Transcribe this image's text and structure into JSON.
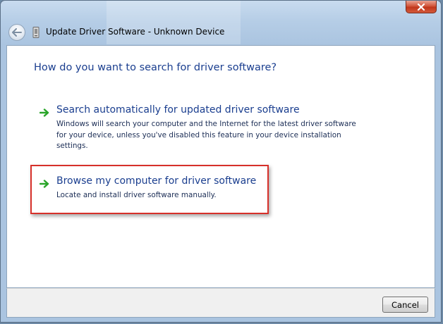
{
  "window": {
    "title": "Update Driver Software - Unknown Device"
  },
  "icons": {
    "back": "back-arrow-icon",
    "device": "device-icon",
    "close": "close-icon",
    "option_arrow": "green-arrow-icon"
  },
  "page": {
    "heading": "How do you want to search for driver software?"
  },
  "options": [
    {
      "title": "Search automatically for updated driver software",
      "description": "Windows will search your computer and the Internet for the latest driver software for your device, unless you've disabled this feature in your device installation settings."
    },
    {
      "title": "Browse my computer for driver software",
      "description": "Locate and install driver software manually."
    }
  ],
  "footer": {
    "cancel_label": "Cancel"
  },
  "colors": {
    "heading": "#1a3e8f",
    "highlight": "#d7302a",
    "arrow": "#2aa52a"
  }
}
